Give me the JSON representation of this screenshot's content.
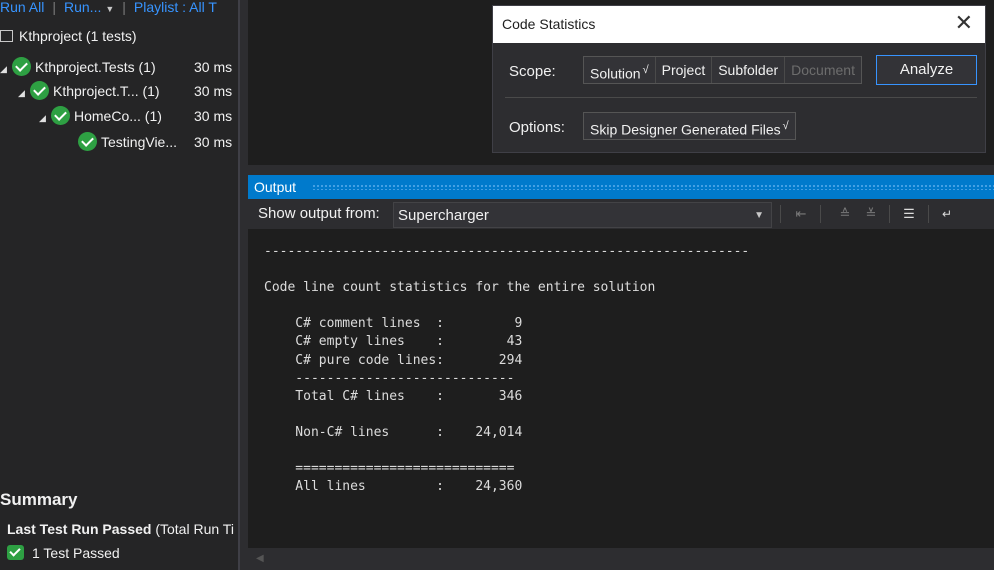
{
  "test_explorer": {
    "toolbar": {
      "run_all": "Run All",
      "run": "Run...",
      "playlist": "Playlist : All T"
    },
    "tree": [
      {
        "label": "Kthproject (1 tests)",
        "duration": ""
      },
      {
        "label": "Kthproject.Tests (1)",
        "duration": "30 ms"
      },
      {
        "label": "Kthproject.T... (1)",
        "duration": "30 ms"
      },
      {
        "label": "HomeCo... (1)",
        "duration": "30 ms"
      },
      {
        "label": "TestingVie...",
        "duration": "30 ms"
      }
    ],
    "summary": {
      "title": "Summary",
      "last_run_bold": "Last Test Run Passed",
      "last_run_rest": " (Total Run Ti",
      "passed": "1 Test Passed"
    }
  },
  "code_statistics_dialog": {
    "title": "Code Statistics",
    "scope_label": "Scope:",
    "scope_options": [
      {
        "label": "Solution",
        "checked": true,
        "enabled": true
      },
      {
        "label": "Project",
        "checked": false,
        "enabled": true
      },
      {
        "label": "Subfolder",
        "checked": false,
        "enabled": true
      },
      {
        "label": "Document",
        "checked": false,
        "enabled": false
      }
    ],
    "analyze_label": "Analyze",
    "options_label": "Options:",
    "options": [
      {
        "label": "Skip Designer Generated Files",
        "checked": true
      }
    ],
    "check_mark": "√"
  },
  "output": {
    "title": "Output",
    "show_output_from_label": "Show output from:",
    "source": "Supercharger",
    "lines": [
      "--------------------------------------------------------------",
      "",
      "Code line count statistics for the entire solution",
      "",
      "    C# comment lines  :         9",
      "    C# empty lines    :        43",
      "    C# pure code lines:       294",
      "    ----------------------------",
      "    Total C# lines    :       346",
      "",
      "    Non-C# lines      :    24,014",
      "",
      "    ============================",
      "    All lines         :    24,360"
    ]
  },
  "colors": {
    "accent": "#007acc",
    "passed": "#2ea043",
    "link": "#3794ff"
  }
}
